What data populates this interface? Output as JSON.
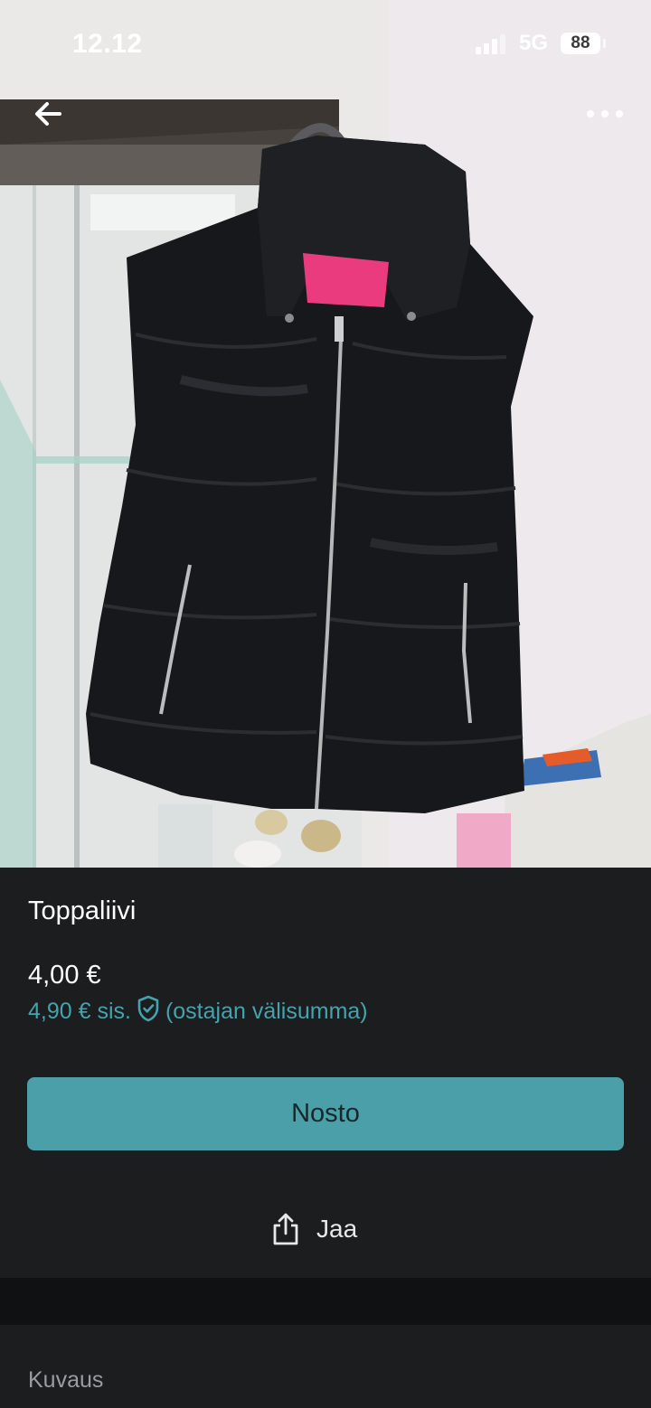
{
  "status_bar": {
    "time": "12.12",
    "network": "5G",
    "battery": "88"
  },
  "product": {
    "image_alt": "Black puffer vest on a hanger",
    "title": "Toppaliivi",
    "price": "4,00 €",
    "buyer_price": "4,90 € sis.",
    "buyer_price_note": "(ostajan välisumma)"
  },
  "actions": {
    "primary_label": "Nosto",
    "share_label": "Jaa"
  },
  "description": {
    "heading": "Kuvaus"
  },
  "icons": {
    "back": "arrow-left-icon",
    "more": "more-dots-icon",
    "shield": "shield-check-icon",
    "share": "share-icon"
  },
  "colors": {
    "accent": "#4a9fa9",
    "accent_text": "#45a3ad",
    "background": "#1b1d1f"
  }
}
